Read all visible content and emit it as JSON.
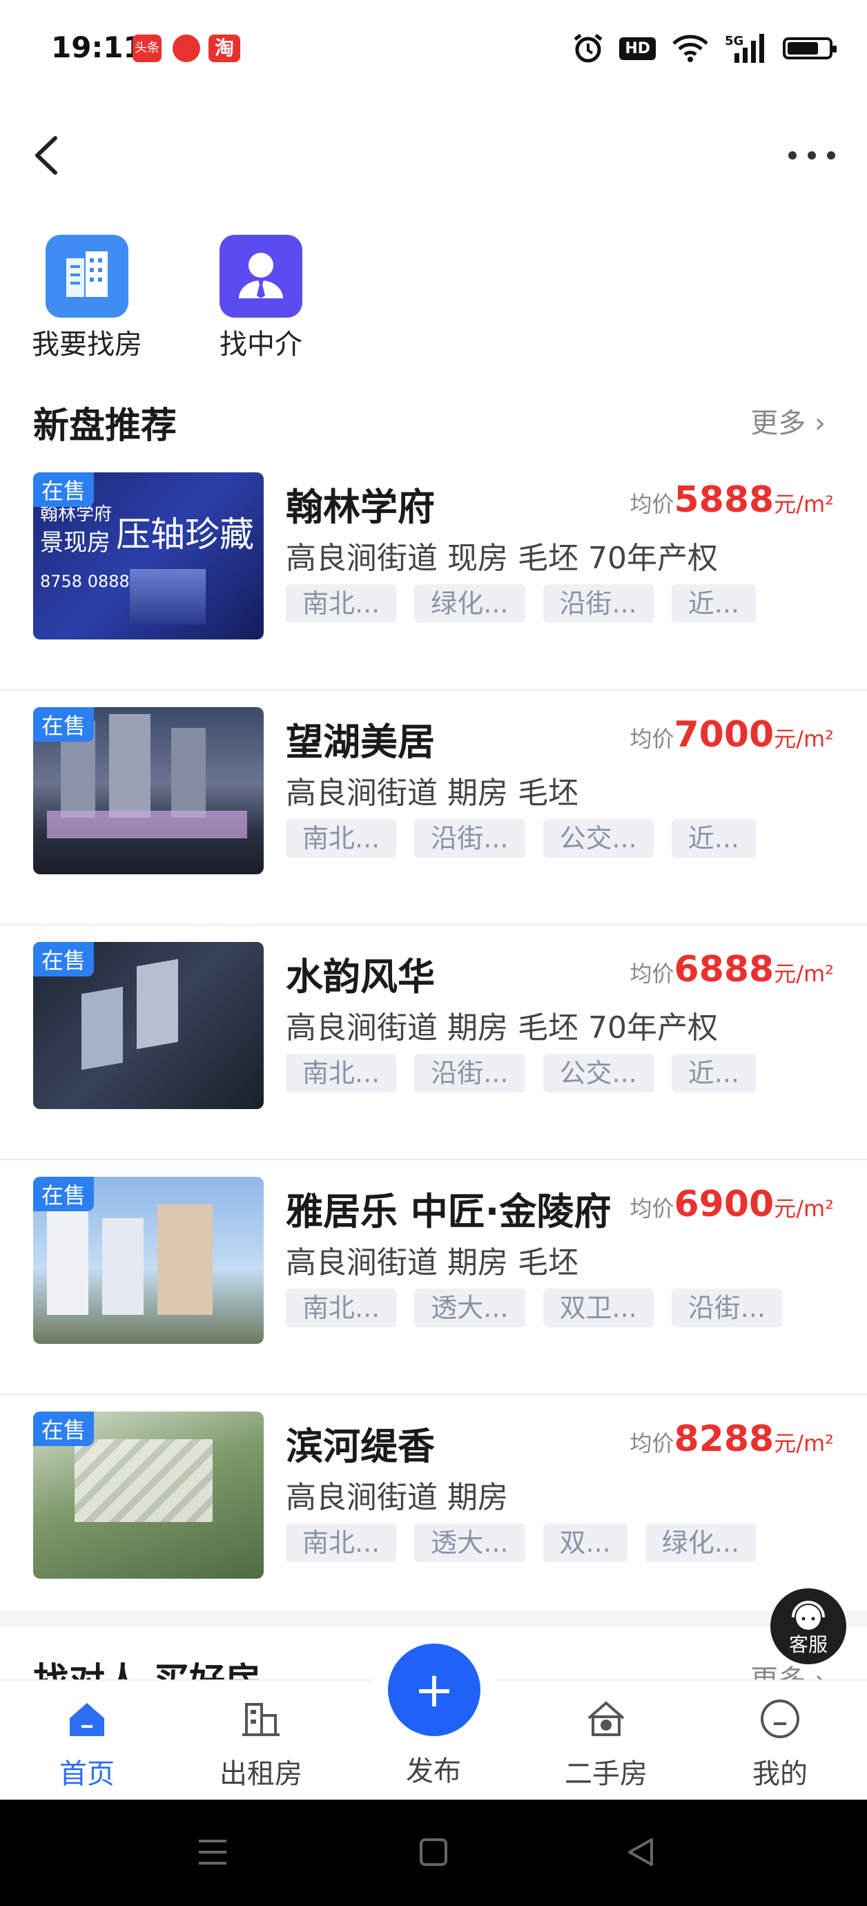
{
  "status": {
    "time": "19:11",
    "badge1": "头条",
    "badge3": "淘",
    "hd": "HD",
    "net": "5G"
  },
  "nav": {
    "back_icon": "chevron-left-icon",
    "more_icon": "more-dots-icon"
  },
  "quick_actions": [
    {
      "label": "我要找房",
      "icon": "building-icon",
      "color": "#3f8cf2"
    },
    {
      "label": "找中介",
      "icon": "agent-icon",
      "color": "#5b4cf0"
    }
  ],
  "section": {
    "title": "新盘推荐",
    "more": "更多"
  },
  "sale_tag": "在售",
  "price_label": "均价",
  "price_unit": "元/m²",
  "listings": [
    {
      "name": "翰林学府",
      "price": "5888",
      "meta": "高良涧街道  现房  毛坯  70年产权",
      "tags": [
        "南北...",
        "绿化...",
        "沿街...",
        "近..."
      ]
    },
    {
      "name": "望湖美居",
      "price": "7000",
      "meta": "高良涧街道  期房  毛坯",
      "tags": [
        "南北...",
        "沿街...",
        "公交...",
        "近..."
      ]
    },
    {
      "name": "水韵风华",
      "price": "6888",
      "meta": "高良涧街道  期房  毛坯  70年产权",
      "tags": [
        "南北...",
        "沿街...",
        "公交...",
        "近..."
      ]
    },
    {
      "name": "雅居乐 中匠·金陵府",
      "price": "6900",
      "meta": "高良涧街道  期房  毛坯",
      "tags": [
        "南北...",
        "透大...",
        "双卫...",
        "沿街..."
      ]
    },
    {
      "name": "滨河缇香",
      "price": "8288",
      "meta": "高良涧街道  期房",
      "tags": [
        "南北...",
        "透大...",
        "双...",
        "绿化..."
      ]
    }
  ],
  "banner_text": {
    "line1": "翰林学府",
    "line2": "景现房",
    "slogan": "压轴珍藏",
    "phone": "8758 0888"
  },
  "next_section": {
    "title": "找对人 买好房",
    "more": "更多"
  },
  "customer_service": "客服",
  "tabs": [
    {
      "label": "首页",
      "icon": "home-icon",
      "active": true
    },
    {
      "label": "出租房",
      "icon": "rent-icon",
      "active": false
    },
    {
      "label": "发布",
      "icon": "plus-icon",
      "active": false
    },
    {
      "label": "二手房",
      "icon": "second-hand-house-icon",
      "active": false
    },
    {
      "label": "我的",
      "icon": "profile-icon",
      "active": false
    }
  ]
}
